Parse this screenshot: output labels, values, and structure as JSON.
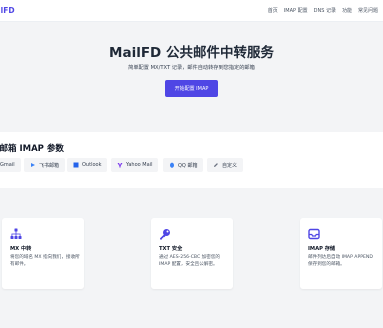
{
  "navbar": {
    "brand": "ailFD",
    "links": [
      "首页",
      "IMAP 配置",
      "DNS 记录",
      "功能",
      "常见问题"
    ]
  },
  "hero": {
    "title": "MailFD 公共邮件中转服务",
    "subtitle": "简单配置 MX/TXT 记录，邮件自动转存到您指定的邮箱",
    "button": "开始配置 IMAP"
  },
  "providers": {
    "title": "写邮箱 IMAP 参数",
    "items": [
      {
        "label": "Gmail",
        "icon": "gmail-icon"
      },
      {
        "label": "飞书邮箱",
        "icon": "feishu-icon"
      },
      {
        "label": "Outlook",
        "icon": "outlook-icon"
      },
      {
        "label": "Yahoo Mail",
        "icon": "yahoo-icon"
      },
      {
        "label": "QQ 邮箱",
        "icon": "qq-icon"
      },
      {
        "label": "自定义",
        "icon": "pencil-icon"
      }
    ]
  },
  "features": [
    {
      "title": "MX 中转",
      "desc": "将您的域名 MX 指向我们，接收所有邮件。",
      "icon": "network-icon"
    },
    {
      "title": "TXT 安全",
      "desc": "通过 AES-256-CBC 加密您的 IMAP 配置，安全且公解密。",
      "icon": "key-icon"
    },
    {
      "title": "IMAP 存储",
      "desc": "邮件列达后自动 IMAP APPEND 保存到您的邮箱。",
      "icon": "inbox-icon"
    }
  ],
  "colors": {
    "accent": "#4f46e5",
    "page_bg": "#f3f4f6",
    "card_bg": "#ffffff"
  }
}
